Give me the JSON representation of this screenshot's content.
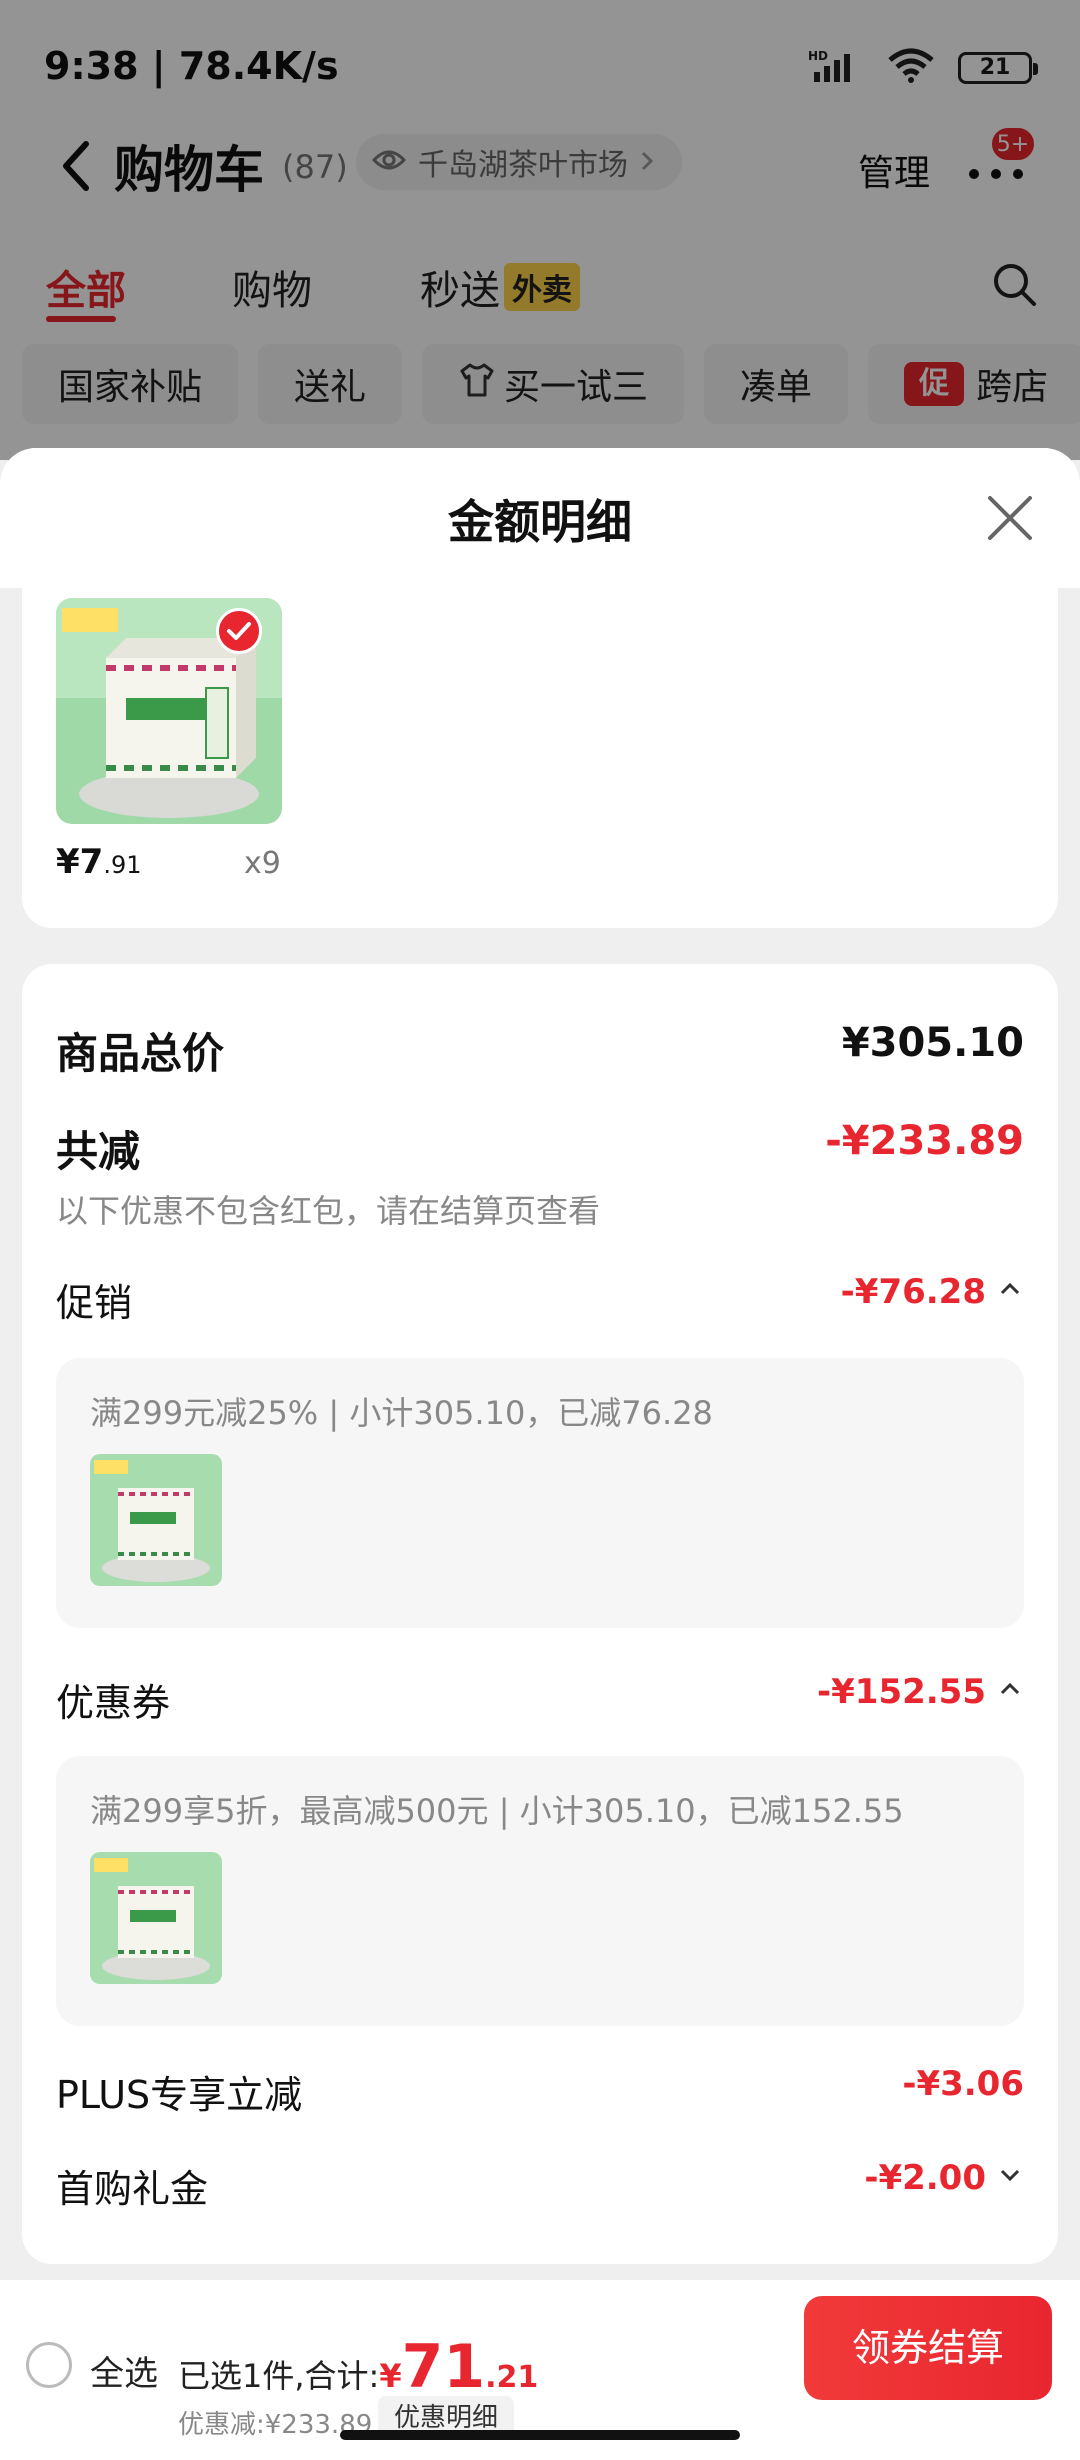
{
  "status_bar": {
    "time": "9:38 | 78.4K/s",
    "network": "HD",
    "battery": "21"
  },
  "nav": {
    "title": "购物车",
    "count": "(87)",
    "location": "千岛湖茶叶市场",
    "manage": "管理",
    "badge": "5+"
  },
  "tabs": [
    {
      "label": "全部",
      "active": true
    },
    {
      "label": "购物",
      "active": false
    },
    {
      "label": "秒送",
      "active": false
    }
  ],
  "tab_badge": "外卖",
  "chips": [
    "国家补贴",
    "送礼",
    "买一试三",
    "凑单",
    "跨店"
  ],
  "chip_promo_tag": "促",
  "sheet": {
    "title": "金额明细",
    "product": {
      "price_int": "¥7",
      "price_dec": ".91",
      "qty": "x9"
    },
    "summary": {
      "total_label": "商品总价",
      "total_value": "¥305.10",
      "reduce_label": "共减",
      "reduce_value": "-¥233.89",
      "reduce_hint": "以下优惠不包含红包，请在结算页查看",
      "promo_label": "促销",
      "promo_value": "-¥76.28",
      "promo_detail": "满299元减25% | 小计305.10，已减76.28",
      "coupon_label": "优惠券",
      "coupon_value": "-¥152.55",
      "coupon_detail": "满299享5折，最高减500元 | 小计305.10，已减152.55",
      "plus_label": "PLUS专享立减",
      "plus_value": "-¥3.06",
      "gift_label": "首购礼金",
      "gift_value": "-¥2.00"
    }
  },
  "bottom": {
    "select_all": "全选",
    "selected": "已选1件,合计:",
    "total_currency": "¥",
    "total_int": "71",
    "total_dec": ".21",
    "discount": "优惠减:¥233.89",
    "detail_button": "优惠明细",
    "checkout": "领券结算"
  },
  "colors": {
    "accent": "#e8262f",
    "badge_yellow": "#ffd24a"
  },
  "icons": [
    "back-arrow-icon",
    "eye-icon",
    "chevron-right-icon",
    "more-dots-icon",
    "search-icon",
    "tshirt-icon",
    "close-icon",
    "check-icon",
    "chevron-up-icon",
    "chevron-down-icon"
  ]
}
